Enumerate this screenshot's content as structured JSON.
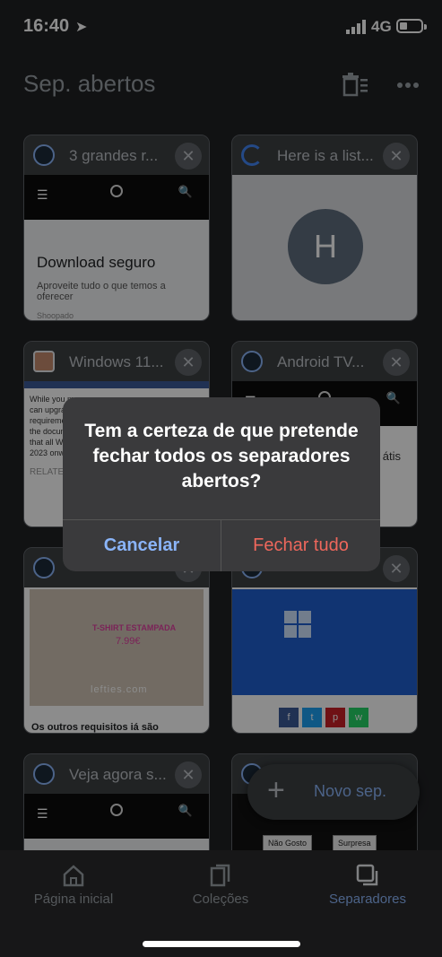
{
  "status": {
    "time": "16:40",
    "network": "4G"
  },
  "header": {
    "title": "Sep. abertos"
  },
  "tabs": [
    {
      "title": "3 grandes r...",
      "favicon_text": "leak",
      "content": {
        "headline": "Download seguro",
        "text": "Aproveite tudo o que temos a oferecer",
        "source": "Shoopado"
      }
    },
    {
      "title": "Here is a list...",
      "content": {
        "letter": "H"
      }
    },
    {
      "title": "Windows 11...",
      "content": {
        "text": "While you m... can upgra... requireme... the docum... that all W... 2023 onw...",
        "related": "RELATE"
      }
    },
    {
      "title": "Android TV...",
      "favicon_text": "leak",
      "content": {
        "partial1": "átis"
      }
    },
    {
      "title": "",
      "content": {
        "ad1": "T-SHIRT ESTAMPADA",
        "price": "7.99€",
        "brand": "lefties.com",
        "caption": "Os outros requisitos iá são"
      }
    },
    {
      "title": "",
      "content": {}
    },
    {
      "title": "Veja agora s...",
      "favicon_text": "leak",
      "content": {}
    },
    {
      "title": "",
      "content": {
        "reaction1": "Não Gosto",
        "reaction2": "Surpresa"
      }
    }
  ],
  "dialog": {
    "message": "Tem a certeza de que pretende fechar todos os separadores abertos?",
    "cancel": "Cancelar",
    "close_all": "Fechar tudo"
  },
  "fab": {
    "label": "Novo sep."
  },
  "bottom_nav": [
    {
      "label": "Página inicial",
      "icon": "home-icon"
    },
    {
      "label": "Coleções",
      "icon": "collections-icon"
    },
    {
      "label": "Separadores",
      "icon": "tabs-icon",
      "active": true
    }
  ],
  "colors": {
    "accent": "#8ab4f8",
    "danger": "#ee675c",
    "background": "#202124"
  }
}
